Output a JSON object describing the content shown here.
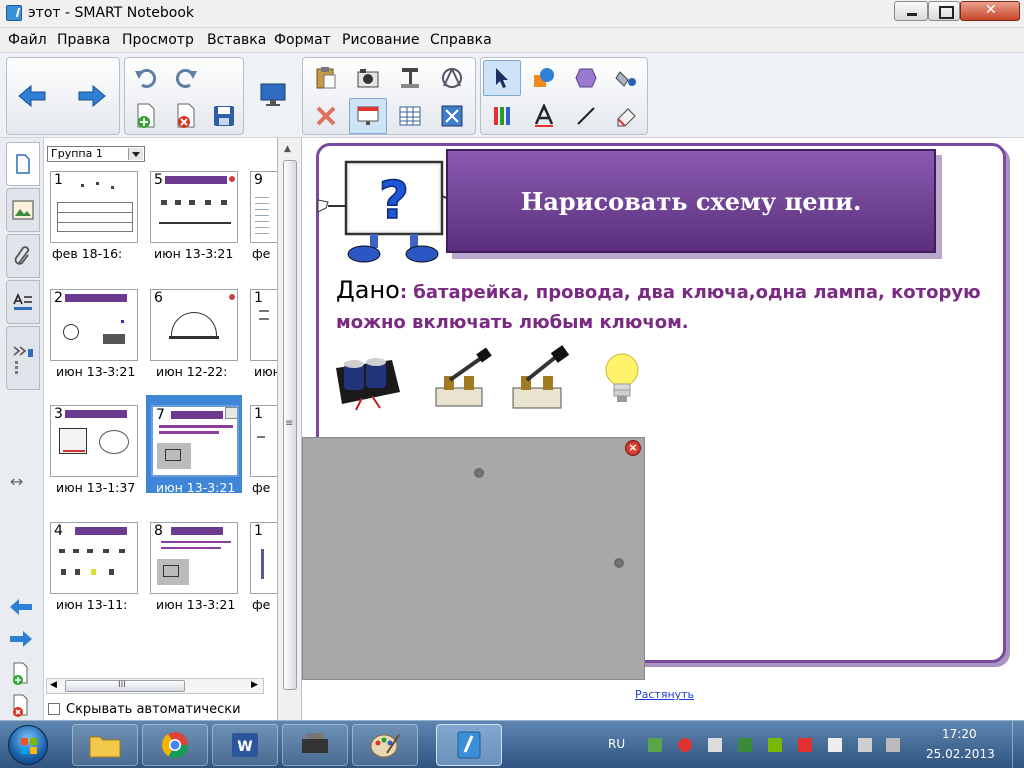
{
  "window": {
    "title": "этот - SMART Notebook"
  },
  "menu": [
    "Файл",
    "Правка",
    "Просмотр",
    "Вставка",
    "Формат",
    "Рисование",
    "Справка"
  ],
  "toolbar": {
    "buttons": [
      "back-icon",
      "forward-icon",
      "undo-icon",
      "redo-icon",
      "blank-page-icon",
      "delete-page-icon",
      "save-icon",
      "screen-icon",
      "paste-icon",
      "camera-icon",
      "document-camera-icon",
      "3d-tools-icon",
      "delete-icon",
      "screen-shade-icon",
      "table-icon",
      "fullscreen-icon",
      "select-icon",
      "shapes-icon",
      "eraser-icon",
      "fill-icon",
      "pens-icon",
      "text-icon",
      "line-icon",
      "creative-pen-icon"
    ]
  },
  "sorter": {
    "group": "Группа 1",
    "thumbs": [
      {
        "num": "1",
        "label": "фев 18-16:"
      },
      {
        "num": "5",
        "label": "июн 13-3:21"
      },
      {
        "num": "9",
        "label": "фе"
      },
      {
        "num": "2",
        "label": "июн 13-3:21"
      },
      {
        "num": "6",
        "label": "июн 12-22:"
      },
      {
        "num": "1",
        "label": "июн"
      },
      {
        "num": "3",
        "label": "июн 13-1:37"
      },
      {
        "num": "7",
        "label": "июн 13-3:21"
      },
      {
        "num": "1",
        "label": "фе"
      },
      {
        "num": "4",
        "label": "июн 13-11:"
      },
      {
        "num": "8",
        "label": "июн 13-3:21"
      },
      {
        "num": "1",
        "label": "фе"
      }
    ],
    "autohide": "Скрывать автоматически",
    "hscroll_mark": "III"
  },
  "page": {
    "title": "Нарисовать  схему цепи.",
    "dano_label": "Дано",
    "dano_text": ": батарейка, провода, два  ключа,одна лампа, которую можно включать  любым  ключом.",
    "stretch": "Растянуть"
  },
  "taskbar": {
    "lang": "RU",
    "time": "17:20",
    "date": "25.02.2013"
  },
  "colors": {
    "accent_purple": "#6b3a8f",
    "title_banner": "#7a4aa0",
    "dano_text": "#7a2a82",
    "selection": "#3f86d8"
  }
}
